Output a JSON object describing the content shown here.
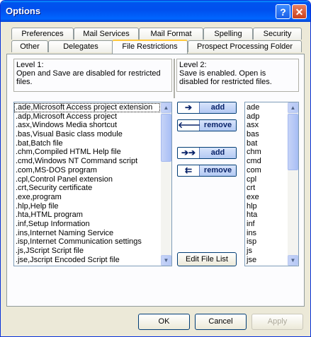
{
  "window": {
    "title": "Options"
  },
  "titlebar": {
    "help_label": "?",
    "close_label": "✕"
  },
  "tabs": {
    "row1": [
      "Preferences",
      "Mail Services",
      "Mail Format",
      "Spelling",
      "Security"
    ],
    "row2": [
      "Other",
      "Delegates",
      "File Restrictions",
      "Prospect Processing Folder"
    ],
    "active": "File Restrictions"
  },
  "level1": {
    "heading": "Level 1:",
    "description": "Open and Save are disabled for restricted files.",
    "items": [
      ".ade,Microsoft Access project extension",
      ".adp,Microsoft Access project",
      ".asx,Windows Media shortcut",
      ".bas,Visual Basic class module",
      ".bat,Batch file",
      ".chm,Compiled HTML Help file",
      ".cmd,Windows NT Command script",
      ".com,MS-DOS program",
      ".cpl,Control Panel extension",
      ".crt,Security certificate",
      ".exe,program",
      ".hlp,Help file",
      ".hta,HTML program",
      ".inf,Setup  Information",
      ".ins,Internet Naming Service",
      ".isp,Internet Communication settings",
      ".js,JScript Script file",
      ".jse,Jscript Encoded Script file"
    ]
  },
  "level2": {
    "heading": "Level 2:",
    "description": "Save is enabled. Open is disabled for restricted files.",
    "items": [
      "ade",
      "adp",
      "asx",
      "bas",
      "bat",
      "chm",
      "cmd",
      "com",
      "cpl",
      "crt",
      "exe",
      "hlp",
      "hta",
      "inf",
      "ins",
      "isp",
      "js",
      "jse"
    ]
  },
  "actions": {
    "add_label": "add",
    "remove_label": "remove",
    "add_all_label": "add",
    "remove_all_label": "remove",
    "edit_file_list_label": "Edit File List"
  },
  "footer": {
    "ok_label": "OK",
    "cancel_label": "Cancel",
    "apply_label": "Apply"
  },
  "colors": {
    "titlebar": "#0054e3",
    "dialog_bg": "#ece9d8",
    "active_tab_accent": "#ffc83c"
  },
  "icons": [
    "help-icon",
    "close-icon",
    "arrow-right-icon",
    "arrow-left-icon",
    "double-arrow-right-icon",
    "double-arrow-left-icon",
    "scroll-up-icon",
    "scroll-down-icon"
  ]
}
